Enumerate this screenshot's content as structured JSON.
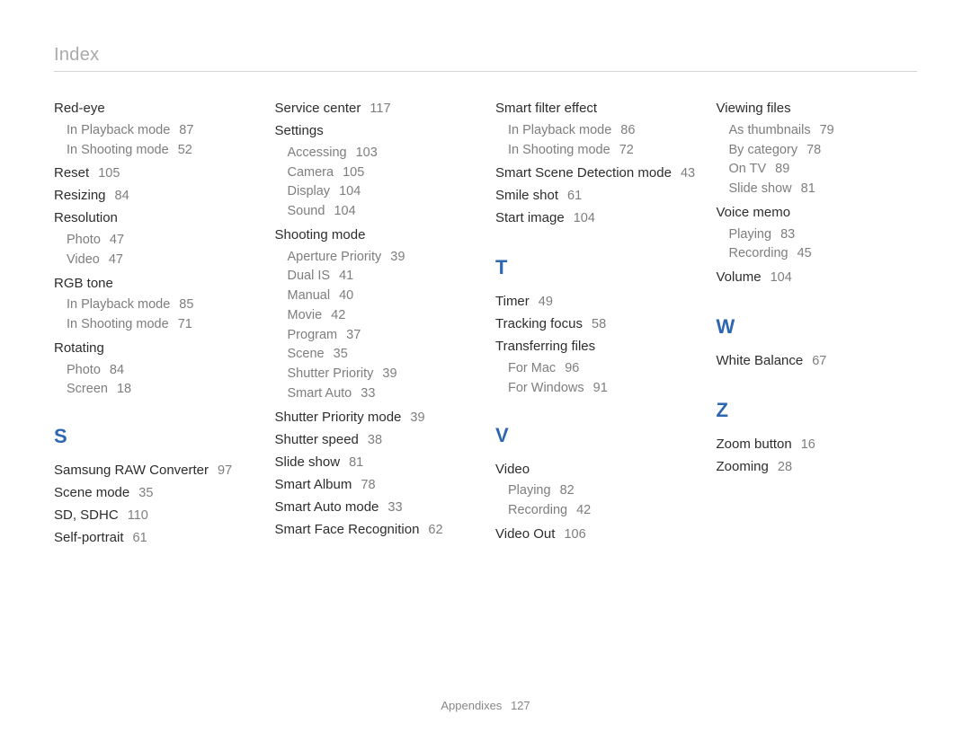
{
  "header": "Index",
  "footer": {
    "label": "Appendixes",
    "page": "127"
  },
  "columns": [
    {
      "items": [
        {
          "t": "entry",
          "label": "Red-eye"
        },
        {
          "t": "sub",
          "label": "In Playback mode",
          "page": "87"
        },
        {
          "t": "sub",
          "label": "In Shooting mode",
          "page": "52"
        },
        {
          "t": "spacer4"
        },
        {
          "t": "entry",
          "label": "Reset",
          "page": "105"
        },
        {
          "t": "entry",
          "label": "Resizing",
          "page": "84"
        },
        {
          "t": "entry",
          "label": "Resolution"
        },
        {
          "t": "sub",
          "label": "Photo",
          "page": "47"
        },
        {
          "t": "sub",
          "label": "Video",
          "page": "47"
        },
        {
          "t": "spacer4"
        },
        {
          "t": "entry",
          "label": "RGB tone"
        },
        {
          "t": "sub",
          "label": "In Playback mode",
          "page": "85"
        },
        {
          "t": "sub",
          "label": "In Shooting mode",
          "page": "71"
        },
        {
          "t": "spacer4"
        },
        {
          "t": "entry",
          "label": "Rotating"
        },
        {
          "t": "sub",
          "label": "Photo",
          "page": "84"
        },
        {
          "t": "sub",
          "label": "Screen",
          "page": "18"
        },
        {
          "t": "gap"
        },
        {
          "t": "letter",
          "label": "S"
        },
        {
          "t": "entry",
          "label": "Samsung RAW Converter",
          "page": "97"
        },
        {
          "t": "entry",
          "label": "Scene mode",
          "page": "35"
        },
        {
          "t": "entry",
          "label": "SD, SDHC",
          "page": "110"
        },
        {
          "t": "entry",
          "label": "Self-portrait",
          "page": "61"
        }
      ]
    },
    {
      "items": [
        {
          "t": "entry",
          "label": "Service center",
          "page": "117"
        },
        {
          "t": "entry",
          "label": "Settings"
        },
        {
          "t": "sub",
          "label": "Accessing",
          "page": "103"
        },
        {
          "t": "sub",
          "label": "Camera",
          "page": "105"
        },
        {
          "t": "sub",
          "label": "Display",
          "page": "104"
        },
        {
          "t": "sub",
          "label": "Sound",
          "page": "104"
        },
        {
          "t": "spacer4"
        },
        {
          "t": "entry",
          "label": "Shooting mode"
        },
        {
          "t": "sub",
          "label": "Aperture Priority",
          "page": "39"
        },
        {
          "t": "sub",
          "label": "Dual IS",
          "page": "41"
        },
        {
          "t": "sub",
          "label": "Manual",
          "page": "40"
        },
        {
          "t": "sub",
          "label": "Movie",
          "page": "42"
        },
        {
          "t": "sub",
          "label": "Program",
          "page": "37"
        },
        {
          "t": "sub",
          "label": "Scene",
          "page": "35"
        },
        {
          "t": "sub",
          "label": "Shutter Priority",
          "page": "39"
        },
        {
          "t": "sub",
          "label": "Smart Auto",
          "page": "33"
        },
        {
          "t": "spacer4"
        },
        {
          "t": "entry",
          "label": "Shutter Priority mode",
          "page": "39"
        },
        {
          "t": "entry",
          "label": "Shutter speed",
          "page": "38"
        },
        {
          "t": "entry",
          "label": "Slide show",
          "page": "81"
        },
        {
          "t": "entry",
          "label": "Smart Album",
          "page": "78"
        },
        {
          "t": "entry",
          "label": "Smart Auto mode",
          "page": "33"
        },
        {
          "t": "entry",
          "label": "Smart Face Recognition",
          "page": "62"
        }
      ]
    },
    {
      "items": [
        {
          "t": "entry",
          "label": "Smart filter effect"
        },
        {
          "t": "sub",
          "label": "In Playback mode",
          "page": "86"
        },
        {
          "t": "sub",
          "label": "In Shooting mode",
          "page": "72"
        },
        {
          "t": "spacer4"
        },
        {
          "t": "entry",
          "label": "Smart Scene Detection mode",
          "page": "43"
        },
        {
          "t": "entry",
          "label": "Smile shot",
          "page": "61"
        },
        {
          "t": "entry",
          "label": "Start image",
          "page": "104"
        },
        {
          "t": "gap"
        },
        {
          "t": "letter",
          "label": "T"
        },
        {
          "t": "entry",
          "label": "Timer",
          "page": "49"
        },
        {
          "t": "entry",
          "label": "Tracking focus",
          "page": "58"
        },
        {
          "t": "entry",
          "label": "Transferring files"
        },
        {
          "t": "sub",
          "label": "For Mac",
          "page": "96"
        },
        {
          "t": "sub",
          "label": "For Windows",
          "page": "91"
        },
        {
          "t": "gap"
        },
        {
          "t": "letter",
          "label": "V"
        },
        {
          "t": "entry",
          "label": "Video"
        },
        {
          "t": "sub",
          "label": "Playing",
          "page": "82"
        },
        {
          "t": "sub",
          "label": "Recording",
          "page": "42"
        },
        {
          "t": "spacer4"
        },
        {
          "t": "entry",
          "label": "Video Out",
          "page": "106"
        }
      ]
    },
    {
      "items": [
        {
          "t": "entry",
          "label": "Viewing files"
        },
        {
          "t": "sub",
          "label": "As thumbnails",
          "page": "79"
        },
        {
          "t": "sub",
          "label": "By category",
          "page": "78"
        },
        {
          "t": "sub",
          "label": "On TV",
          "page": "89"
        },
        {
          "t": "sub",
          "label": "Slide show",
          "page": "81"
        },
        {
          "t": "spacer4"
        },
        {
          "t": "entry",
          "label": "Voice memo"
        },
        {
          "t": "sub",
          "label": "Playing",
          "page": "83"
        },
        {
          "t": "sub",
          "label": "Recording",
          "page": "45"
        },
        {
          "t": "spacer4"
        },
        {
          "t": "entry",
          "label": "Volume",
          "page": "104"
        },
        {
          "t": "gap"
        },
        {
          "t": "letter",
          "label": "W"
        },
        {
          "t": "entry",
          "label": "White Balance",
          "page": "67"
        },
        {
          "t": "gap"
        },
        {
          "t": "letter",
          "label": "Z"
        },
        {
          "t": "entry",
          "label": "Zoom button",
          "page": "16"
        },
        {
          "t": "entry",
          "label": "Zooming",
          "page": "28"
        }
      ]
    }
  ]
}
